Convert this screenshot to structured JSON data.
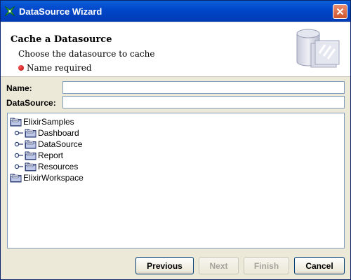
{
  "window": {
    "title": "DataSource Wizard"
  },
  "header": {
    "title": "Cache a Datasource",
    "description": "Choose the datasource to cache",
    "error": "Name required"
  },
  "form": {
    "name_label": "Name:",
    "name_value": "",
    "datasource_label": "DataSource:",
    "datasource_value": ""
  },
  "tree": {
    "nodes": [
      {
        "label": "ElixirSamples",
        "level": 0,
        "icon": "folder-open-icon"
      },
      {
        "label": "Dashboard",
        "level": 1,
        "icon": "folder-icon"
      },
      {
        "label": "DataSource",
        "level": 1,
        "icon": "folder-icon"
      },
      {
        "label": "Report",
        "level": 1,
        "icon": "folder-icon"
      },
      {
        "label": "Resources",
        "level": 1,
        "icon": "folder-icon"
      },
      {
        "label": "ElixirWorkspace",
        "level": 0,
        "icon": "folder-icon"
      }
    ]
  },
  "buttons": {
    "previous": "Previous",
    "next": "Next",
    "finish": "Finish",
    "cancel": "Cancel"
  },
  "colors": {
    "titlebar": "#0046c9",
    "error": "#d00000",
    "field_border": "#7f9db9"
  }
}
